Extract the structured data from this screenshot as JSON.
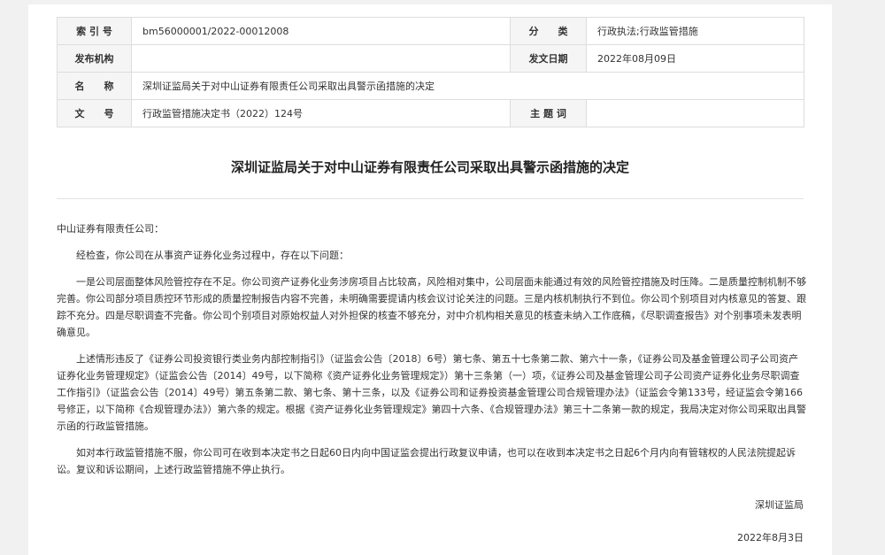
{
  "meta": {
    "index_label": "索 引 号",
    "index_value": "bm56000001/2022-00012008",
    "category_label": "分　　类",
    "category_value": "行政执法;行政监管措施",
    "publisher_label": "发布机构",
    "publisher_value": "",
    "date_label": "发文日期",
    "date_value": "2022年08月09日",
    "name_label": "名　　称",
    "name_value": "深圳证监局关于对中山证券有限责任公司采取出具警示函措施的决定",
    "docno_label": "文　　号",
    "docno_value": "行政监管措施决定书（2022）124号",
    "subject_label": "主 题 词",
    "subject_value": ""
  },
  "document": {
    "title": "深圳证监局关于对中山证券有限责任公司采取出具警示函措施的决定",
    "salutation": "中山证券有限责任公司：",
    "paragraphs": [
      "经检查，你公司在从事资产证券化业务过程中，存在以下问题：",
      "一是公司层面整体风险管控存在不足。你公司资产证券化业务涉房项目占比较高，风险相对集中，公司层面未能通过有效的风险管控措施及时压降。二是质量控制机制不够完善。你公司部分项目质控环节形成的质量控制报告内容不完善，未明确需要提请内核会议讨论关注的问题。三是内核机制执行不到位。你公司个别项目对内核意见的答复、跟踪不充分。四是尽职调查不完备。你公司个别项目对原始权益人对外担保的核查不够充分，对中介机构相关意见的核查未纳入工作底稿，《尽职调查报告》对个别事项未发表明确意见。",
      "上述情形违反了《证券公司投资银行类业务内部控制指引》（证监会公告〔2018〕6号）第七条、第五十七条第二款、第六十一条，《证券公司及基金管理公司子公司资产证券化业务管理规定》（证监会公告〔2014〕49号，以下简称《资产证券化业务管理规定》）第十三条第（一）项，《证券公司及基金管理公司子公司资产证券化业务尽职调查工作指引》（证监会公告〔2014〕49号）第五条第二款、第七条、第十三条，以及《证券公司和证券投资基金管理公司合规管理办法》（证监会令第133号，经证监会令第166号修正，以下简称《合规管理办法》）第六条的规定。根据《资产证券化业务管理规定》第四十六条、《合规管理办法》第三十二条第一款的规定，我局决定对你公司采取出具警示函的行政监管措施。",
      "如对本行政监管措施不服，你公司可在收到本决定书之日起60日内向中国证监会提出行政复议申请，也可以在收到本决定书之日起6个月内向有管辖权的人民法院提起诉讼。复议和诉讼期间，上述行政监管措施不停止执行。"
    ],
    "signature": "深圳证监局",
    "sign_date": "2022年8月3日"
  }
}
